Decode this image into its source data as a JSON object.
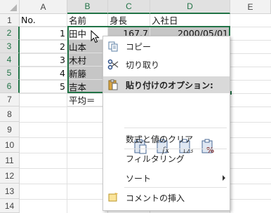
{
  "columns": [
    "A",
    "B",
    "C",
    "D",
    "E"
  ],
  "rows": [
    "1",
    "2",
    "3",
    "4",
    "5",
    "6",
    "7",
    "8",
    "9",
    "10",
    "11",
    "12",
    "13",
    "14"
  ],
  "cells": {
    "A1": "No.",
    "B1": "名前",
    "C1": "身長",
    "D1": "入社日",
    "A2": "1",
    "B2": "田中",
    "C2": "167.7",
    "D2": "2000/05/01",
    "A3": "2",
    "B3": "山本",
    "A4": "3",
    "B4": "木村",
    "A5": "4",
    "B5": "新籐",
    "A6": "5",
    "B6": "吉本",
    "B7": "平均＝"
  },
  "context_menu": {
    "copy": "コピー",
    "cut": "切り取り",
    "paste_options": "貼り付けのオプション:",
    "paste_buttons": [
      "paste-all-icon",
      "paste-formula-icon",
      "paste-values-icon",
      "paste-formatting-icon"
    ],
    "clear": "数式と値のクリア",
    "filter": "フィルタリング",
    "sort": "ソート",
    "insert_comment": "コメントの挿入"
  },
  "colors": {
    "accent": "#217346",
    "selection_fill": "#c6c6c6",
    "menu_highlight": "#d9d9d9"
  }
}
